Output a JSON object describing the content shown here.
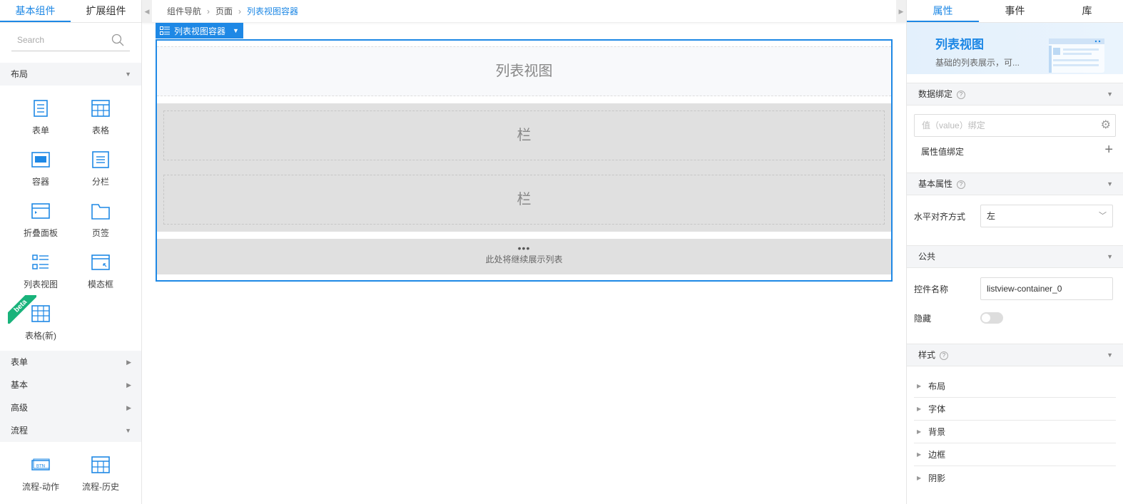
{
  "left": {
    "tabs": [
      "基本组件",
      "扩展组件"
    ],
    "search_placeholder": "Search",
    "categories": {
      "layout": "布局",
      "form": "表单",
      "basic": "基本",
      "advanced": "高级",
      "flow": "流程"
    },
    "layout_items": [
      "表单",
      "表格",
      "容器",
      "分栏",
      "折叠面板",
      "页签",
      "列表视图",
      "模态框",
      "表格(新)"
    ],
    "beta_label": "beta",
    "flow_items": [
      "流程-动作",
      "流程-历史"
    ]
  },
  "center": {
    "breadcrumb": [
      "组件导航",
      "页面",
      "列表视图容器"
    ],
    "tag_label": "列表视图容器",
    "header_text": "列表视图",
    "column_text": "栏",
    "more_dots": "•••",
    "more_text": "此处将继续展示列表"
  },
  "right": {
    "tabs": [
      "属性",
      "事件",
      "库"
    ],
    "banner_title": "列表视图",
    "banner_desc": "基础的列表展示，可...",
    "sections": {
      "binding": "数据绑定",
      "basic": "基本属性",
      "common": "公共",
      "style": "样式"
    },
    "binding_placeholder": "值（value）绑定",
    "prop_binding_label": "属性值绑定",
    "align_label": "水平对齐方式",
    "align_value": "左",
    "name_label": "控件名称",
    "name_value": "listview-container_0",
    "hide_label": "隐藏",
    "hide_on": false,
    "style_items": [
      "布局",
      "字体",
      "背景",
      "边框",
      "阴影"
    ]
  },
  "accent_color": "#1e88e5"
}
